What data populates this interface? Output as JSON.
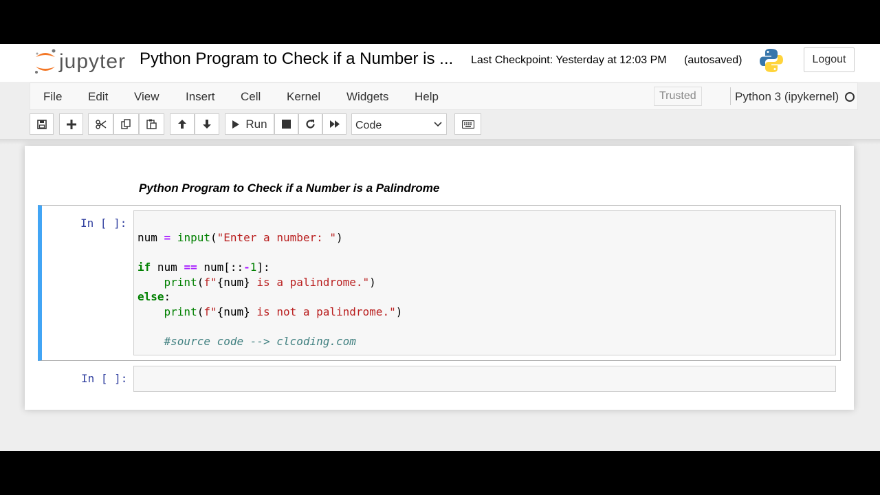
{
  "header": {
    "logo_text": "jupyter",
    "notebook_title": "Python Program to Check if a Number is ...",
    "checkpoint": "Last Checkpoint: Yesterday at 12:03 PM",
    "autosave": "(autosaved)",
    "logout_label": "Logout"
  },
  "menubar": {
    "items": [
      "File",
      "Edit",
      "View",
      "Insert",
      "Cell",
      "Kernel",
      "Widgets",
      "Help"
    ],
    "trusted": "Trusted",
    "kernel": "Python 3 (ipykernel)"
  },
  "toolbar": {
    "run_label": "Run",
    "cell_type": "Code"
  },
  "notebook": {
    "markdown_heading": "Python Program to Check if a Number is a Palindrome",
    "cells": [
      {
        "prompt": "In [ ]:",
        "code_lines": [
          "num = input(\"Enter a number: \")",
          "",
          "if num == num[::-1]:",
          "    print(f\"{num} is a palindrome.\")",
          "else:",
          "    print(f\"{num} is not a palindrome.\")",
          "",
          "    #source code --> clcoding.com"
        ]
      },
      {
        "prompt": "In [ ]:",
        "code_lines": []
      }
    ]
  },
  "colors": {
    "selected_cell_bar": "#42a5f5",
    "prompt": "#303f9f",
    "keyword": "#008000",
    "string": "#ba2121",
    "comment": "#408080",
    "operator": "#aa22ff"
  }
}
